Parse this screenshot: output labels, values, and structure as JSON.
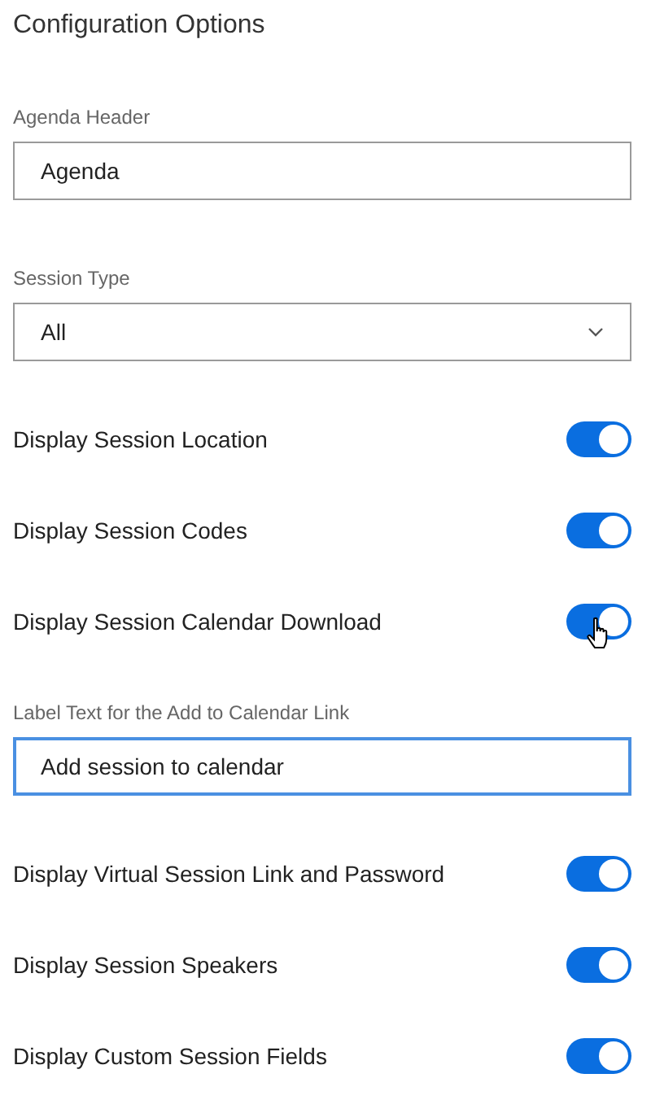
{
  "title": "Configuration Options",
  "fields": [
    {
      "kind": "text",
      "label": "Agenda Header",
      "value": "Agenda",
      "focused": false
    },
    {
      "kind": "select",
      "label": "Session Type",
      "value": "All"
    },
    {
      "kind": "toggle",
      "label": "Display Session Location",
      "on": true
    },
    {
      "kind": "toggle",
      "label": "Display Session Codes",
      "on": true
    },
    {
      "kind": "toggle",
      "label": "Display Session Calendar Download",
      "on": true
    },
    {
      "kind": "text",
      "label": "Label Text for the Add to Calendar Link",
      "value": "Add session to calendar",
      "focused": true
    },
    {
      "kind": "toggle",
      "label": "Display Virtual Session Link and Password",
      "on": true
    },
    {
      "kind": "toggle",
      "label": "Display Session Speakers",
      "on": true
    },
    {
      "kind": "toggle",
      "label": "Display Custom Session Fields",
      "on": true
    }
  ]
}
